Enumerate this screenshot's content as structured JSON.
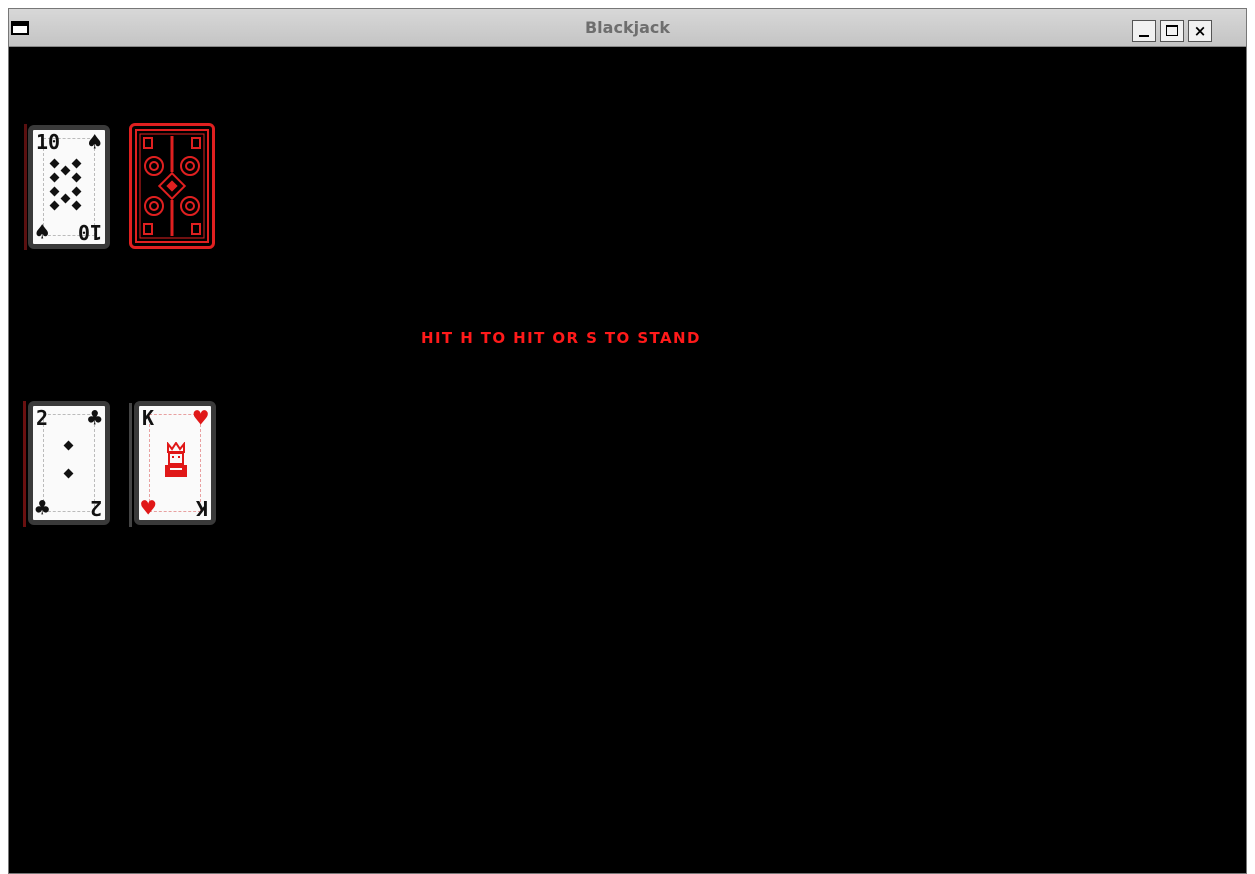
{
  "window": {
    "title": "Blackjack",
    "buttons": {
      "minimize": "_",
      "maximize": "□",
      "close": "×"
    }
  },
  "dealer": {
    "cards": [
      {
        "rank": "10",
        "suit": "spade",
        "suit_glyph": "♠",
        "face_up": true,
        "color": "#111111"
      },
      {
        "face_up": false,
        "back_color": "#e02020"
      }
    ]
  },
  "player": {
    "cards": [
      {
        "rank": "2",
        "suit": "club",
        "suit_glyph": "♣",
        "face_up": true,
        "color": "#111111"
      },
      {
        "rank": "K",
        "suit": "heart",
        "suit_glyph": "♥",
        "face_up": true,
        "color": "#e01818",
        "figure": "king"
      }
    ]
  },
  "prompt": {
    "text": "HIT H TO HIT OR S TO STAND",
    "color": "#ff1a1a"
  },
  "colors": {
    "table": "#000000",
    "titlebar": "#c8c8c8",
    "card_face": "#fafafa",
    "card_border": "#3a3a3a"
  }
}
